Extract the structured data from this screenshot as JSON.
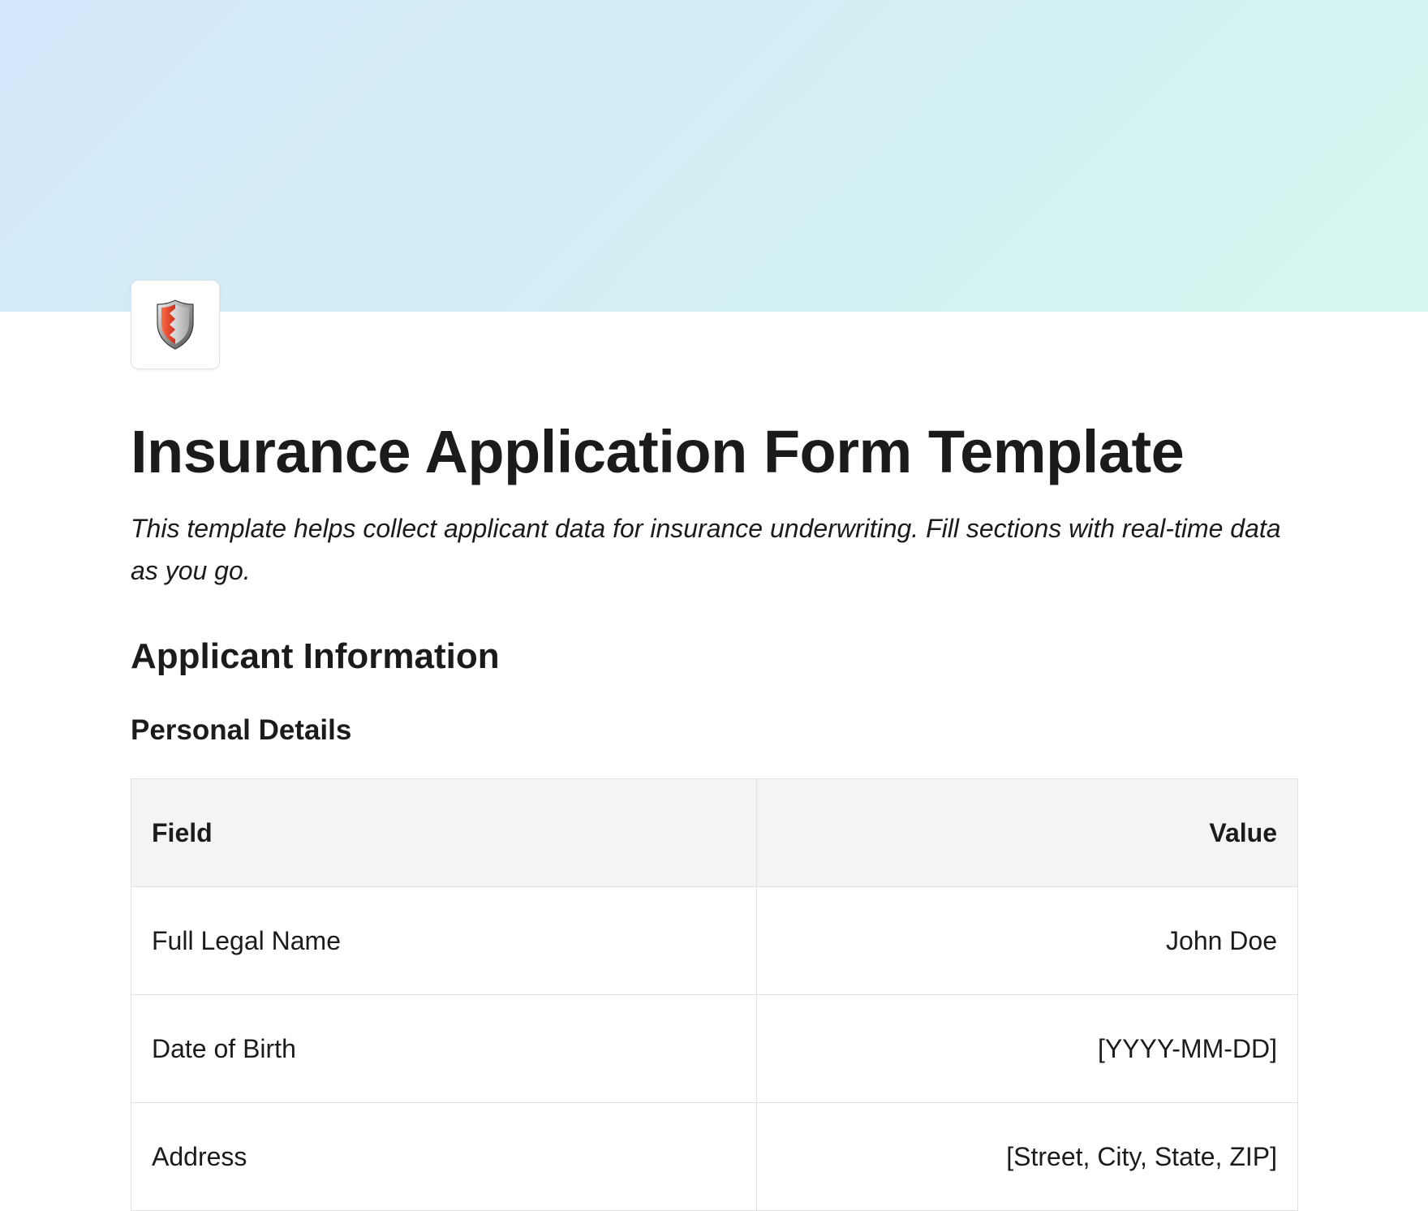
{
  "page": {
    "icon": "shield-icon",
    "title": "Insurance Application Form Template",
    "subtitle": "This template helps collect applicant data for insurance underwriting. Fill sections with real-time data as you go."
  },
  "sections": {
    "applicant_heading": "Applicant Information",
    "personal_heading": "Personal Details"
  },
  "personal_table": {
    "headers": {
      "field": "Field",
      "value": "Value"
    },
    "rows": [
      {
        "field": "Full Legal Name",
        "value": "John Doe"
      },
      {
        "field": "Date of Birth",
        "value": "[YYYY-MM-DD]"
      },
      {
        "field": "Address",
        "value": "[Street, City, State, ZIP]"
      }
    ]
  },
  "colors": {
    "cover_start": "#d3e7fa",
    "cover_end": "#d6f7f0",
    "shield_red": "#e04a2f",
    "text": "#1b1b1b",
    "table_header_bg": "#f4f4f4",
    "border": "#e2e2e2"
  }
}
